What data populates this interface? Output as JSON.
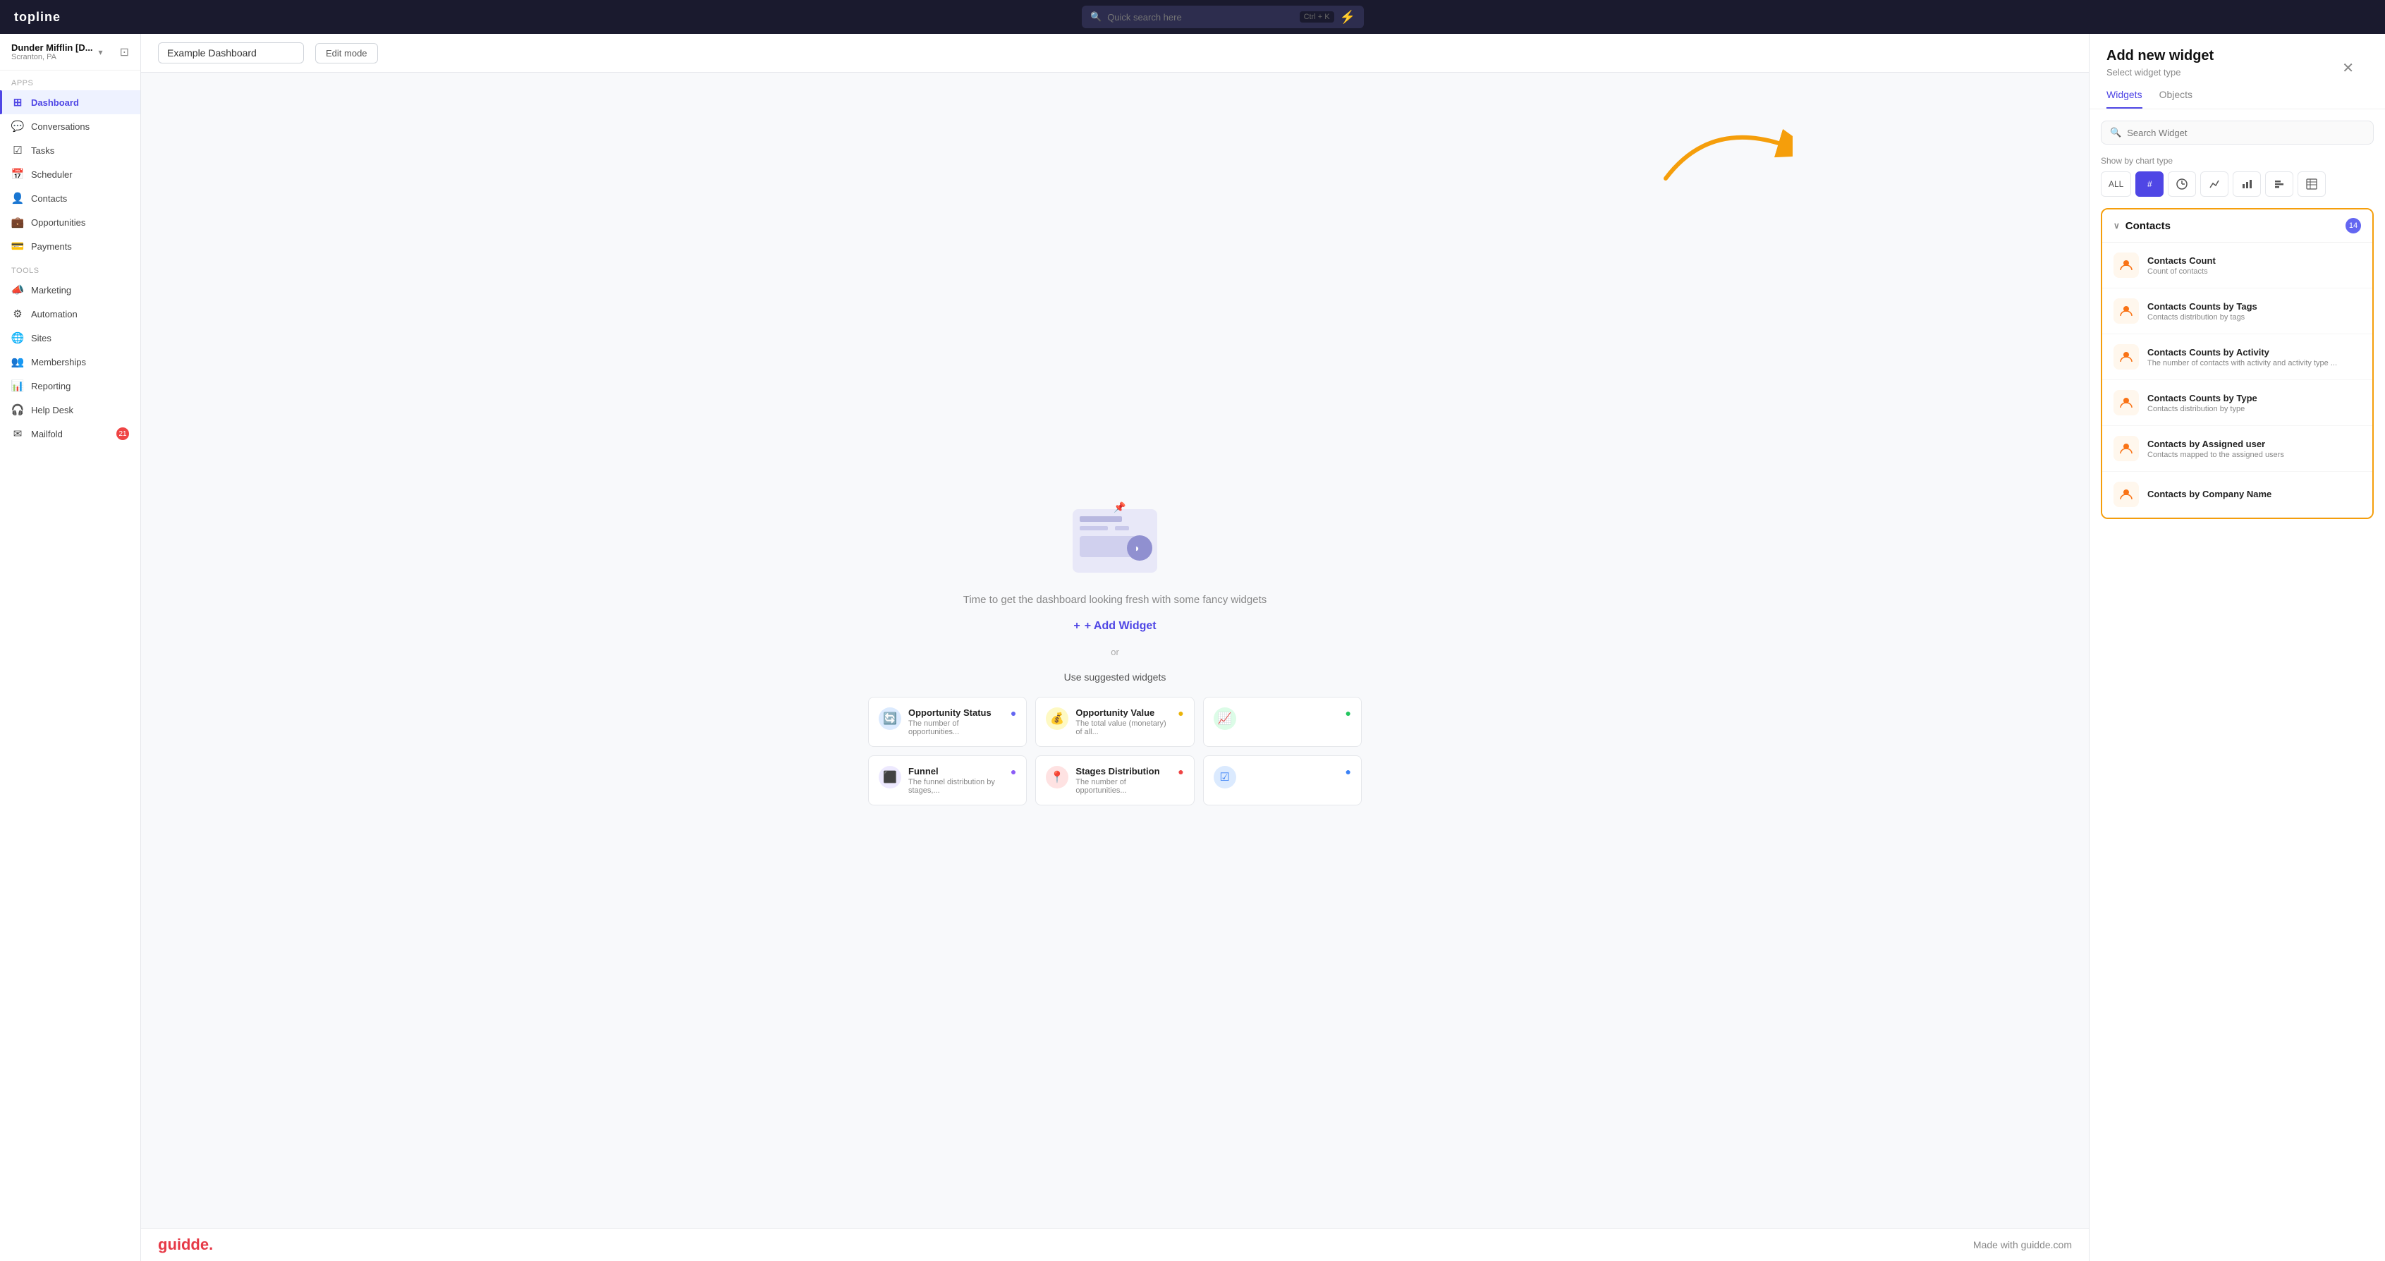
{
  "topbar": {
    "logo": "topline",
    "search_placeholder": "Quick search here",
    "search_shortcut": "Ctrl + K",
    "lightning_icon": "⚡"
  },
  "sidebar": {
    "workspace": {
      "name": "Dunder Mifflin [D...",
      "location": "Scranton, PA"
    },
    "apps_label": "Apps",
    "tools_label": "Tools",
    "nav_items": [
      {
        "id": "dashboard",
        "label": "Dashboard",
        "icon": "⊞",
        "active": true
      },
      {
        "id": "conversations",
        "label": "Conversations",
        "icon": "💬",
        "active": false
      },
      {
        "id": "tasks",
        "label": "Tasks",
        "icon": "☑",
        "active": false
      },
      {
        "id": "scheduler",
        "label": "Scheduler",
        "icon": "📅",
        "active": false
      },
      {
        "id": "contacts",
        "label": "Contacts",
        "icon": "👤",
        "active": false
      },
      {
        "id": "opportunities",
        "label": "Opportunities",
        "icon": "💼",
        "active": false
      },
      {
        "id": "payments",
        "label": "Payments",
        "icon": "💳",
        "active": false
      }
    ],
    "tool_items": [
      {
        "id": "marketing",
        "label": "Marketing",
        "icon": "📣"
      },
      {
        "id": "automation",
        "label": "Automation",
        "icon": "⚙"
      },
      {
        "id": "sites",
        "label": "Sites",
        "icon": "🌐"
      },
      {
        "id": "memberships",
        "label": "Memberships",
        "icon": "👥"
      },
      {
        "id": "reporting",
        "label": "Reporting",
        "icon": "📊"
      },
      {
        "id": "helpdesk",
        "label": "Help Desk",
        "icon": "🎧"
      },
      {
        "id": "mailfold",
        "label": "Mailfold",
        "icon": "✉",
        "badge": "21"
      }
    ]
  },
  "content": {
    "dashboard_title": "Example Dashboard",
    "edit_mode_label": "Edit mode",
    "empty_text": "Time to get the dashboard looking fresh with some fancy widgets",
    "add_widget_label": "+ Add Widget",
    "or_text": "or",
    "suggested_label": "Use suggested widgets",
    "suggested_items": [
      {
        "id": "opp-status",
        "name": "Opportunity Status",
        "desc": "The number of opportunities...",
        "icon": "🔵",
        "icon_bg": "#dbeafe",
        "check_color": "#6366f1"
      },
      {
        "id": "opp-value",
        "name": "Opportunity Value",
        "desc": "The total value (monetary) of all...",
        "icon": "🟡",
        "icon_bg": "#fef9c3",
        "check_color": "#eab308"
      },
      {
        "id": "revenue",
        "name": "",
        "desc": "",
        "icon": "🟢",
        "icon_bg": "#dcfce7",
        "check_color": "#22c55e"
      },
      {
        "id": "funnel",
        "name": "Funnel",
        "desc": "The funnel distribution by stages,...",
        "icon": "🔷",
        "icon_bg": "#ede9fe",
        "check_color": "#8b5cf6"
      },
      {
        "id": "stages",
        "name": "Stages Distribution",
        "desc": "The number of opportunities...",
        "icon": "🔴",
        "icon_bg": "#fee2e2",
        "check_color": "#ef4444"
      },
      {
        "id": "extra",
        "name": "",
        "desc": "",
        "icon": "🔵",
        "icon_bg": "#dbeafe",
        "check_color": "#3b82f6"
      }
    ]
  },
  "panel": {
    "title": "Add new widget",
    "subtitle": "Select widget type",
    "close_icon": "✕",
    "tabs": [
      {
        "id": "widgets",
        "label": "Widgets",
        "active": true
      },
      {
        "id": "objects",
        "label": "Objects",
        "active": false
      }
    ],
    "search_placeholder": "Search Widget",
    "chart_type_label": "Show by chart type",
    "chart_types": [
      {
        "id": "all",
        "label": "ALL",
        "active": false
      },
      {
        "id": "hash",
        "label": "#",
        "active": true
      },
      {
        "id": "clock",
        "label": "◔",
        "active": false
      },
      {
        "id": "line",
        "label": "↗",
        "active": false
      },
      {
        "id": "bar",
        "label": "▦",
        "active": false
      },
      {
        "id": "gantt",
        "label": "≡",
        "active": false
      },
      {
        "id": "table",
        "label": "⊞",
        "active": false
      }
    ],
    "contacts_section": {
      "title": "Contacts",
      "badge": "14",
      "chevron": "∨",
      "widgets": [
        {
          "id": "contacts-count",
          "name": "Contacts Count",
          "desc": "Count of contacts"
        },
        {
          "id": "contacts-tags",
          "name": "Contacts Counts by Tags",
          "desc": "Contacts distribution by tags"
        },
        {
          "id": "contacts-activity",
          "name": "Contacts Counts by Activity",
          "desc": "The number of contacts with activity and activity type ..."
        },
        {
          "id": "contacts-type",
          "name": "Contacts Counts by Type",
          "desc": "Contacts distribution by type"
        },
        {
          "id": "contacts-assigned",
          "name": "Contacts by Assigned user",
          "desc": "Contacts mapped to the assigned users"
        },
        {
          "id": "contacts-company",
          "name": "Contacts by Company Name",
          "desc": ""
        }
      ]
    }
  },
  "bottom": {
    "logo": "guidde.",
    "tagline": "Made with guidde.com"
  }
}
